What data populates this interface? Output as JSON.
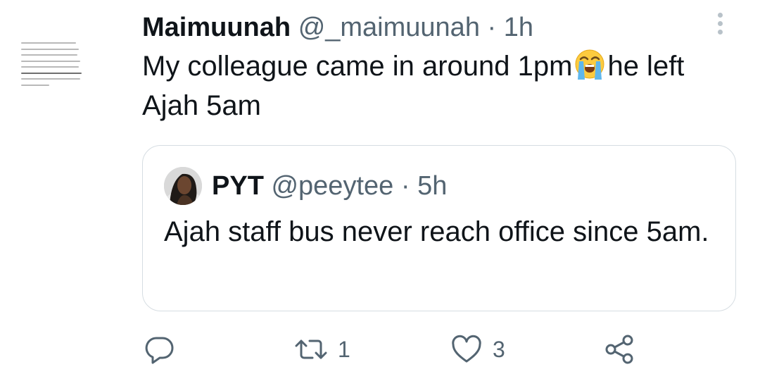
{
  "tweet": {
    "author_name": "Maimuunah",
    "author_handle": "@_maimuunah",
    "separator": "·",
    "time": "1h",
    "text_before_emoji": "My colleague came in around 1pm",
    "text_after_emoji": "he left Ajah 5am",
    "emoji_icon": "loudly-crying-face-icon"
  },
  "quoted_tweet": {
    "author_name": "PYT",
    "author_handle": "@peeytee",
    "separator": "·",
    "time": "5h",
    "text": "Ajah staff bus never reach office since 5am."
  },
  "actions": {
    "reply_icon": "reply-icon",
    "retweet_icon": "retweet-icon",
    "retweet_count": "1",
    "like_icon": "heart-icon",
    "like_count": "3",
    "share_icon": "share-icon"
  },
  "colors": {
    "text": "#0f1419",
    "secondary": "#536471",
    "border": "#d6dde2"
  }
}
